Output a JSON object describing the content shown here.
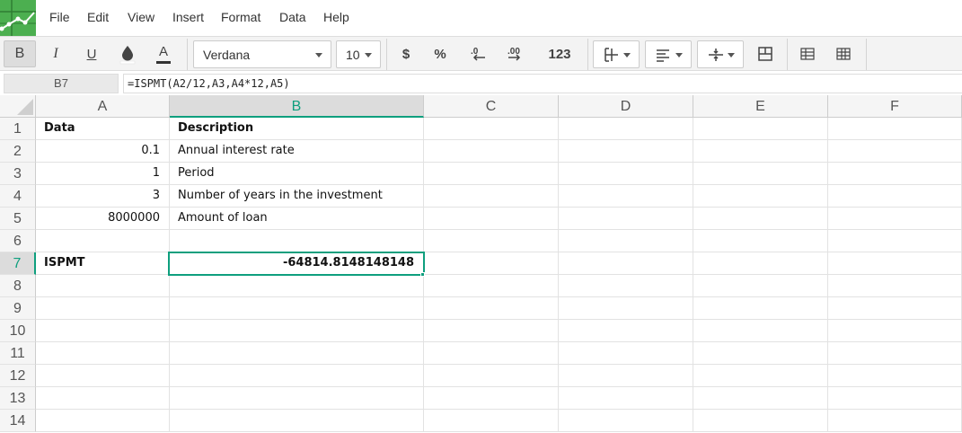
{
  "menu": {
    "file": "File",
    "edit": "Edit",
    "view": "View",
    "insert": "Insert",
    "format": "Format",
    "data": "Data",
    "help": "Help"
  },
  "toolbar": {
    "bold": "B",
    "italic": "I",
    "underline": "U",
    "text_color": "A",
    "currency": "$",
    "percent": "%",
    "decrease_decimals": ".0",
    "increase_decimals": ".00",
    "number_format": "123",
    "font_family": "Verdana",
    "font_size": "10"
  },
  "formula_bar": {
    "cell_ref": "B7",
    "formula": "=ISPMT(A2/12,A3,A4*12,A5)"
  },
  "sheet": {
    "columns": [
      "A",
      "B",
      "C",
      "D",
      "E",
      "F"
    ],
    "rows": [
      "1",
      "2",
      "3",
      "4",
      "5",
      "6",
      "7",
      "8",
      "9",
      "10",
      "11",
      "12",
      "13",
      "14"
    ],
    "selected_cell": "B7",
    "cells": {
      "A1": "Data",
      "B1": "Description",
      "A2": "0.1",
      "B2": "Annual interest rate",
      "A3": "1",
      "B3": "Period",
      "A4": "3",
      "B4": "Number of years in the investment",
      "A5": "8000000",
      "B5": "Amount of loan",
      "A7": "ISPMT",
      "B7": "-64814.8148148148"
    }
  },
  "colors": {
    "accent": "#0e9f7e",
    "logo": "#4caf50",
    "toolbar_bg": "#f3f3f3",
    "header_bg": "#f5f5f5"
  }
}
